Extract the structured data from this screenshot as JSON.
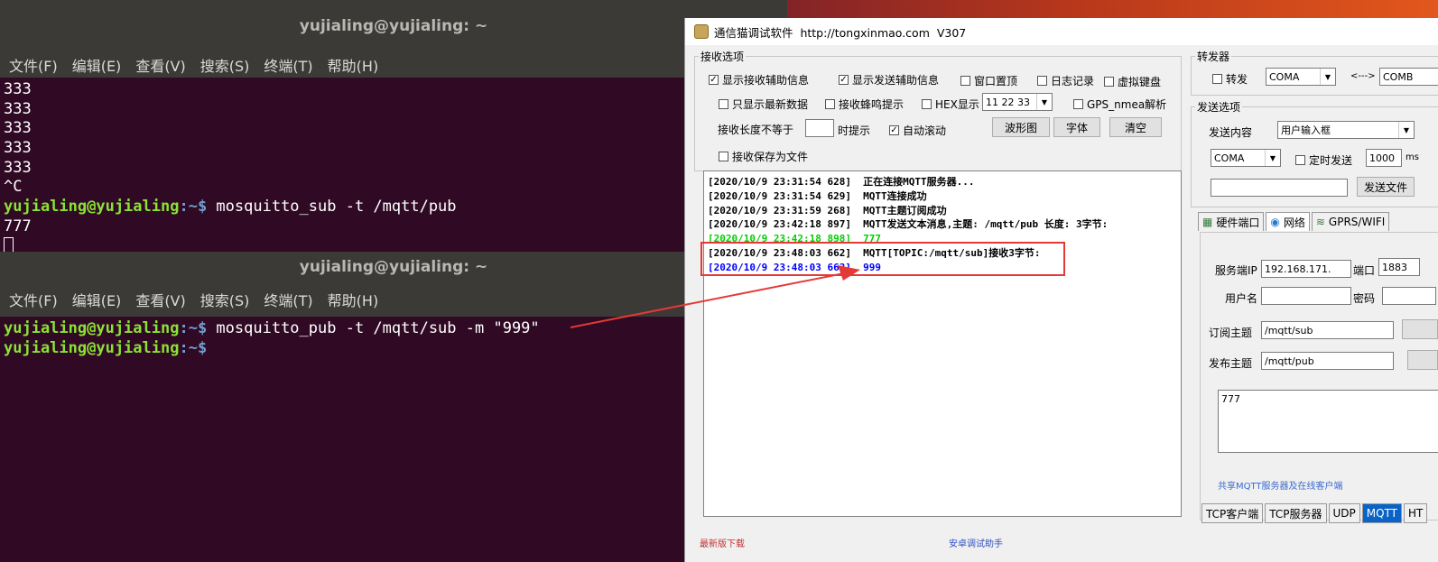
{
  "terminal1": {
    "title": "yujialing@yujialing: ~",
    "menu": [
      "文件(F)",
      "编辑(E)",
      "查看(V)",
      "搜索(S)",
      "终端(T)",
      "帮助(H)"
    ],
    "output_before": [
      "333",
      "333",
      "333",
      "333",
      "333",
      "^C"
    ],
    "prompt_user": "yujialing@yujialing",
    "prompt_path": ":~$",
    "command": " mosquitto_sub -t /mqtt/pub",
    "output_after": [
      "777"
    ]
  },
  "terminal2": {
    "title": "yujialing@yujialing: ~",
    "menu": [
      "文件(F)",
      "编辑(E)",
      "查看(V)",
      "搜索(S)",
      "终端(T)",
      "帮助(H)"
    ],
    "prompt_user": "yujialing@yujialing",
    "prompt_path": ":~$",
    "command": " mosquitto_pub -t /mqtt/sub -m \"999\""
  },
  "app": {
    "title": "通信猫调试软件  http://tongxinmao.com  V307",
    "receive_group": {
      "legend": "接收选项",
      "show_rx_info": "显示接收辅助信息",
      "show_tx_info": "显示发送辅助信息",
      "window_top": "窗口置顶",
      "log_record": "日志记录",
      "virtual_kb": "虚拟键盘",
      "only_latest": "只显示最新数据",
      "rx_beep": "接收蜂鸣提示",
      "hex_display": "HEX显示",
      "hex_value": "11 22 33",
      "gps_parse": "GPS_nmea解析",
      "rx_len_label": "接收长度不等于",
      "rx_len_suffix": "时提示",
      "auto_scroll": "自动滚动",
      "waveform_btn": "波形图",
      "font_btn": "字体",
      "clear_btn": "清空",
      "save_to_file": "接收保存为文件"
    },
    "log": [
      {
        "ts": "[2020/10/9 23:31:54 628]",
        "msg": "正在连接MQTT服务器...",
        "color": "black"
      },
      {
        "ts": "[2020/10/9 23:31:54 629]",
        "msg": "MQTT连接成功",
        "color": "black"
      },
      {
        "ts": "[2020/10/9 23:31:59 268]",
        "msg": "MQTT主题订阅成功",
        "color": "black"
      },
      {
        "ts": "[2020/10/9 23:42:18 897]",
        "msg": "MQTT发送文本消息,主题: /mqtt/pub 长度: 3字节:",
        "color": "black"
      },
      {
        "ts": "[2020/10/9 23:42:18 898]",
        "msg": "777",
        "color": "green"
      },
      {
        "ts": "[2020/10/9 23:48:03 662]",
        "msg": "MQTT[TOPIC:/mqtt/sub]接收3字节:",
        "color": "black"
      },
      {
        "ts": "[2020/10/9 23:48:03 663]",
        "msg": "999",
        "color": "blue"
      }
    ],
    "forwarder": {
      "legend": "转发器",
      "forward": "转发",
      "port_a": "COMA",
      "arrow": "<--->",
      "port_b": "COMB"
    },
    "send_group": {
      "legend": "发送选项",
      "content_label": "发送内容",
      "content_value": "用户输入框",
      "port": "COMA",
      "timed_send": "定时发送",
      "interval": "1000",
      "interval_unit": "ms",
      "send_file_btn": "发送文件"
    },
    "top_tabs": [
      "硬件端口",
      "网络",
      "GPRS/WIFI"
    ],
    "network": {
      "server_ip_label": "服务端IP",
      "server_ip": "192.168.171.",
      "port_label": "端口",
      "port": "1883",
      "user_label": "用户名",
      "pass_label": "密码",
      "sub_topic_label": "订阅主题",
      "sub_topic": "/mqtt/sub",
      "pub_topic_label": "发布主题",
      "pub_topic": "/mqtt/pub",
      "message": "777",
      "shared_link": "共享MQTT服务器及在线客户端"
    },
    "bottom_tabs": [
      "TCP客户端",
      "TCP服务器",
      "UDP",
      "MQTT",
      "HT"
    ],
    "footer_left": "最新版下载",
    "footer_right": "安卓调试助手"
  },
  "colors": {
    "terminal_bg": "#300a24",
    "prompt_user": "#8ae234",
    "prompt_path": "#729fcf",
    "highlight_red": "#e53935"
  }
}
